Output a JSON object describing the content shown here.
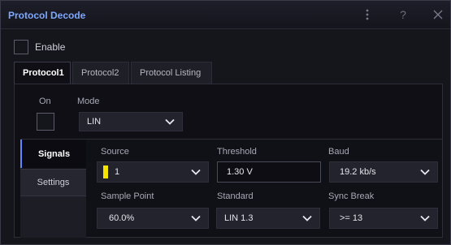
{
  "window": {
    "title": "Protocol Decode",
    "menu_icon": "kebab-icon",
    "help_glyph": "?",
    "close_icon": "close-icon"
  },
  "enable": {
    "label": "Enable",
    "checked": false
  },
  "tabs": [
    {
      "label": "Protocol1",
      "active": true
    },
    {
      "label": "Protocol2",
      "active": false
    },
    {
      "label": "Protocol Listing",
      "active": false
    }
  ],
  "protocol": {
    "on_label": "On",
    "on_checked": false,
    "mode_label": "Mode",
    "mode_value": "LIN"
  },
  "side_tabs": [
    {
      "label": "Signals",
      "active": true
    },
    {
      "label": "Settings",
      "active": false
    }
  ],
  "signals": {
    "source": {
      "label": "Source",
      "value": "1",
      "channel_color": "#f4e400"
    },
    "threshold": {
      "label": "Threshold",
      "value": "1.30 V"
    },
    "baud": {
      "label": "Baud",
      "value": "19.2 kb/s"
    },
    "sample_point": {
      "label": "Sample Point",
      "value": "60.0%"
    },
    "standard": {
      "label": "Standard",
      "value": "LIN 1.3"
    },
    "sync_break": {
      "label": "Sync Break",
      "value": ">= 13"
    }
  },
  "colors": {
    "title_accent": "#7ea8ff",
    "background": "#0f0f15",
    "dropdown_bg": "#23232d"
  }
}
